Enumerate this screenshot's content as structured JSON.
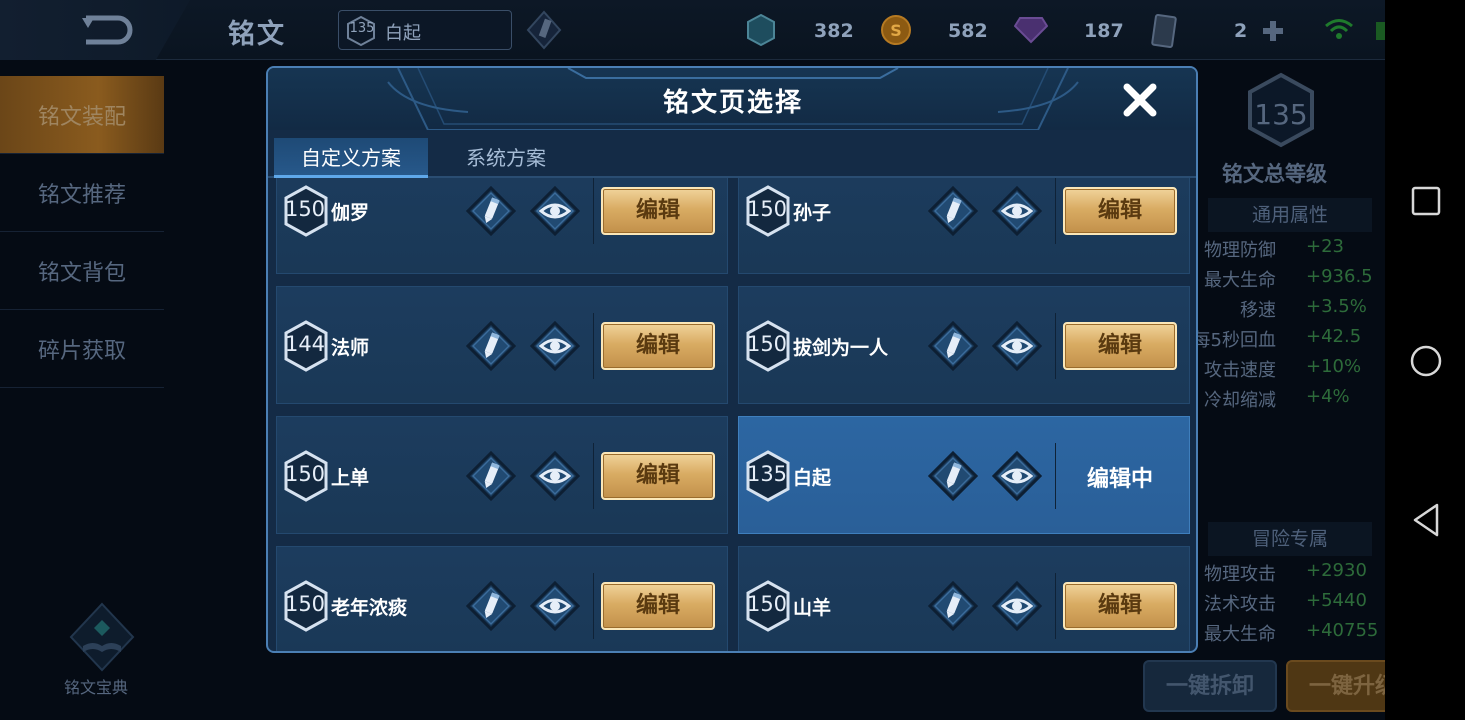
{
  "topbar": {
    "title": "铭文",
    "hero_level": "135",
    "hero_name": "白起",
    "resources": [
      {
        "icon": "crystal-icon",
        "value": "382"
      },
      {
        "icon": "gold-coin-icon",
        "value": "582"
      },
      {
        "icon": "gem-icon",
        "value": "187"
      },
      {
        "icon": "card-icon",
        "value": "2"
      }
    ]
  },
  "sidebar": {
    "items": [
      {
        "label": "铭文装配",
        "active": true
      },
      {
        "label": "铭文推荐",
        "active": false
      },
      {
        "label": "铭文背包",
        "active": false
      },
      {
        "label": "碎片获取",
        "active": false
      }
    ],
    "codex_label": "铭文宝典"
  },
  "right_panel": {
    "total_level": "135",
    "total_label": "铭文总等级",
    "general_header": "通用属性",
    "general_attrs": [
      {
        "name": "物理防御",
        "value": "+23"
      },
      {
        "name": "最大生命",
        "value": "+936.5"
      },
      {
        "name": "移速",
        "value": "+3.5%"
      },
      {
        "name": "每5秒回血",
        "value": "+42.5"
      },
      {
        "name": "攻击速度",
        "value": "+10%"
      },
      {
        "name": "冷却缩减",
        "value": "+4%"
      }
    ],
    "adventure_header": "冒险专属",
    "adventure_attrs": [
      {
        "name": "物理攻击",
        "value": "+2930"
      },
      {
        "name": "法术攻击",
        "value": "+5440"
      },
      {
        "name": "最大生命",
        "value": "+40755"
      }
    ],
    "unequip_label": "一键拆卸",
    "upgrade_label": "一键升级"
  },
  "modal": {
    "title": "铭文页选择",
    "tabs": [
      {
        "label": "自定义方案",
        "active": true
      },
      {
        "label": "系统方案",
        "active": false
      }
    ],
    "edit_label": "编辑",
    "editing_label": "编辑中",
    "pages": [
      {
        "level": "150",
        "name": "伽罗",
        "selected": false
      },
      {
        "level": "150",
        "name": "孙子",
        "selected": false
      },
      {
        "level": "144",
        "name": "法师",
        "selected": false
      },
      {
        "level": "150",
        "name": "拔剑为一人",
        "selected": false
      },
      {
        "level": "150",
        "name": "上单",
        "selected": false
      },
      {
        "level": "135",
        "name": "白起",
        "selected": true
      },
      {
        "level": "150",
        "name": "老年浓痰",
        "selected": false
      },
      {
        "level": "150",
        "name": "山羊",
        "selected": false
      }
    ]
  },
  "colors": {
    "accent_blue": "#4b7fb4",
    "gold_button": "#d9ac63",
    "selected_card": "#2c66a2",
    "stat_green": "#2d6b3a"
  }
}
